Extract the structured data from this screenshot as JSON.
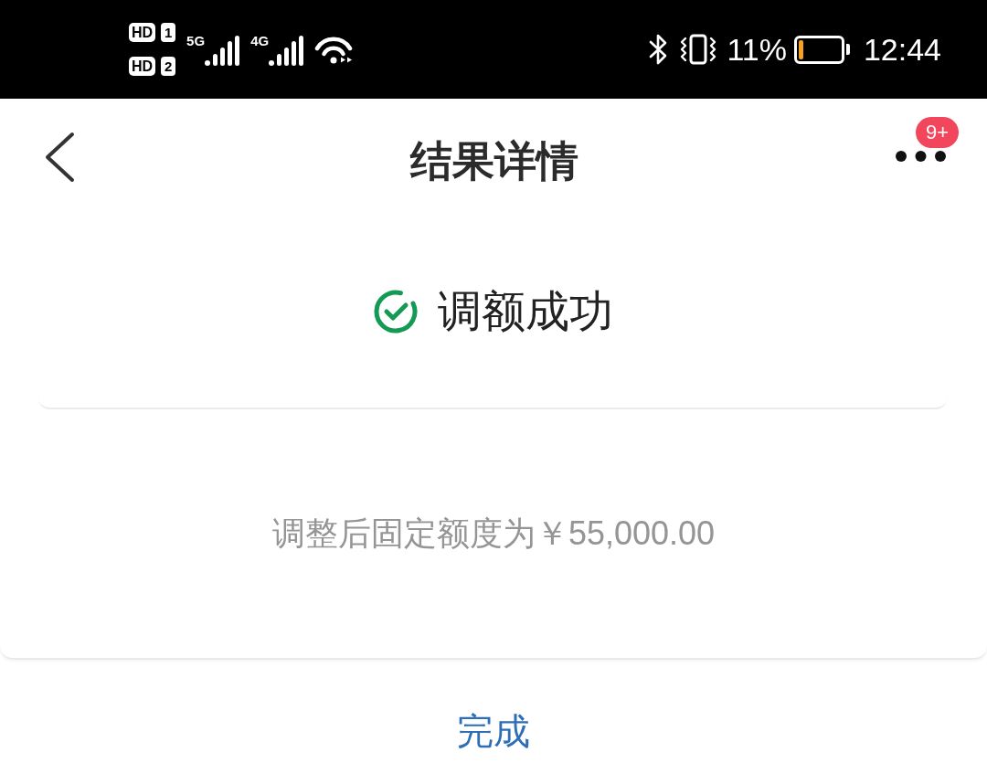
{
  "status_bar": {
    "sim_slots": [
      {
        "badge": "HD",
        "slot": "1"
      },
      {
        "badge": "HD",
        "slot": "2"
      }
    ],
    "networks": [
      {
        "type": "5G"
      },
      {
        "type": "4G"
      }
    ],
    "battery": {
      "percent": "11%",
      "level": 0.11
    },
    "time": "12:44"
  },
  "header": {
    "title": "结果详情",
    "more": {
      "badge": "9+"
    }
  },
  "result": {
    "kind": "success",
    "title": "调额成功"
  },
  "detail": {
    "text": "调整后固定额度为￥55,000.00"
  },
  "action": {
    "label": "完成"
  }
}
